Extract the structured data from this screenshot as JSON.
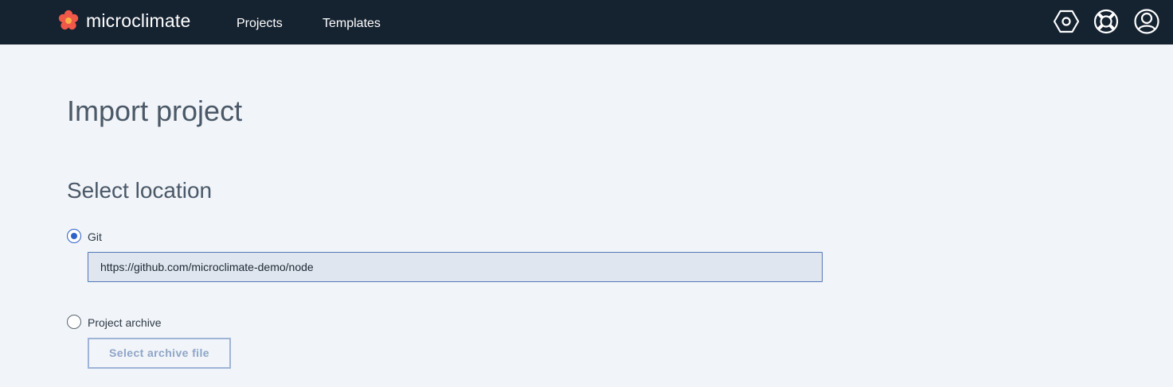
{
  "header": {
    "brand_name": "microclimate",
    "nav": [
      {
        "label": "Projects"
      },
      {
        "label": "Templates"
      }
    ],
    "icons": [
      "settings-icon",
      "help-icon",
      "user-icon"
    ],
    "background_color": "#152230",
    "logo_color": "#f0584a"
  },
  "main": {
    "title": "Import project",
    "section_title": "Select location",
    "options": [
      {
        "label": "Git",
        "selected": true
      },
      {
        "label": "Project archive",
        "selected": false
      }
    ],
    "git_url": "https://github.com/microclimate-demo/node",
    "archive_button_label": "Select archive file"
  }
}
